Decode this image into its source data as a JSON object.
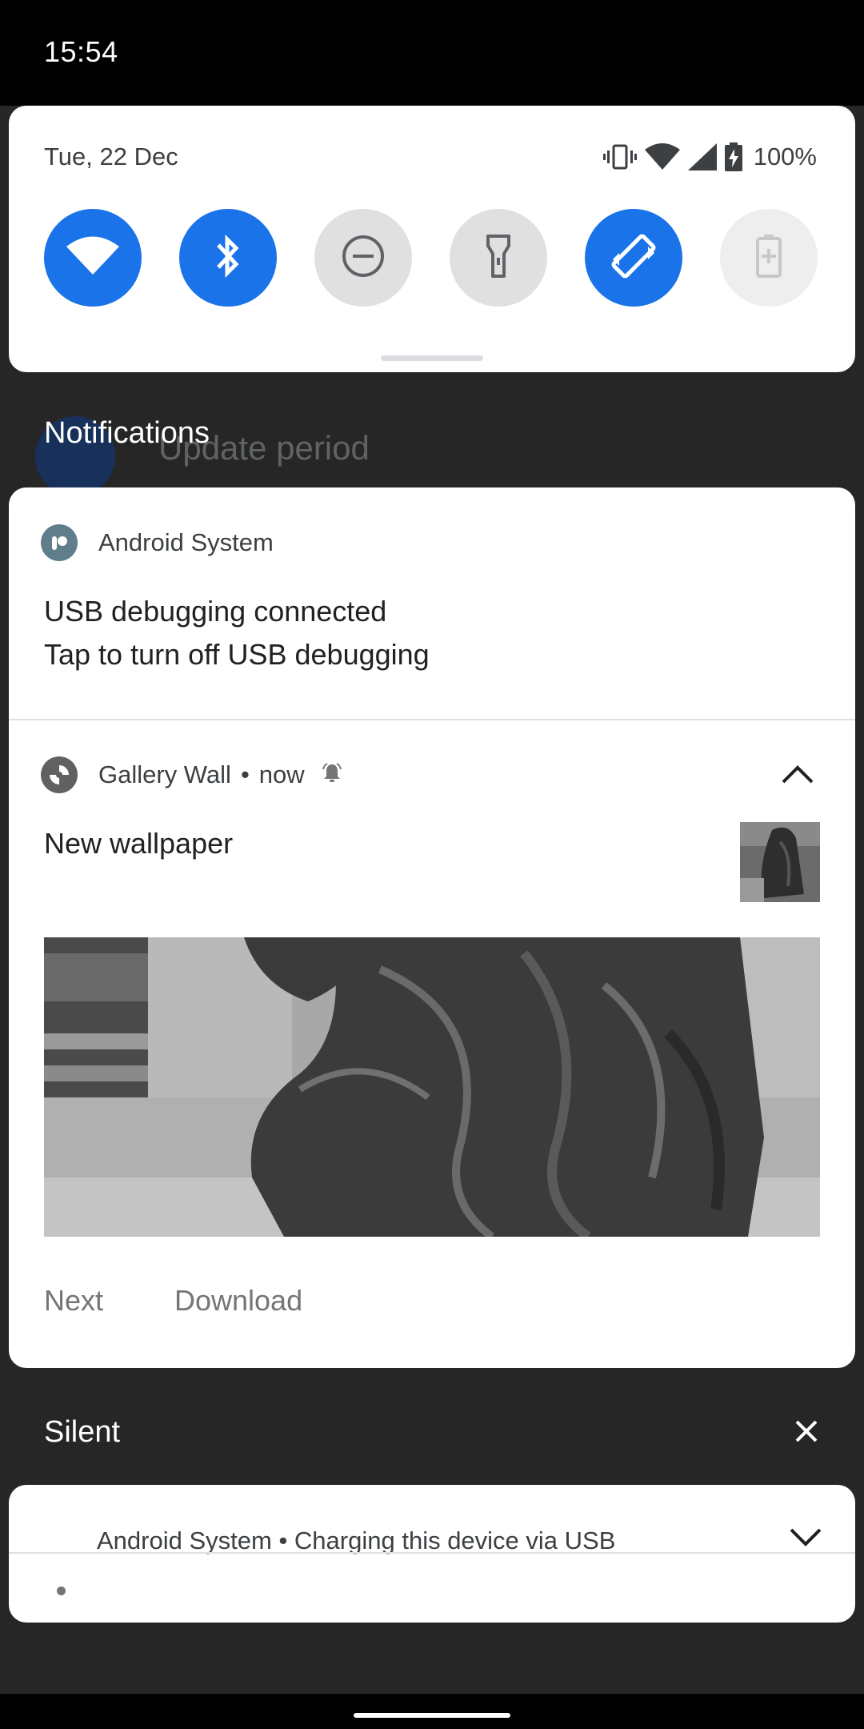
{
  "status_bar": {
    "time": "15:54"
  },
  "quick_settings": {
    "date": "Tue, 22 Dec",
    "battery": "100%",
    "tiles": [
      {
        "name": "Wi-Fi",
        "icon": "wifi-icon",
        "state": "on"
      },
      {
        "name": "Bluetooth",
        "icon": "bluetooth-icon",
        "state": "on"
      },
      {
        "name": "Do Not Disturb",
        "icon": "dnd-icon",
        "state": "off"
      },
      {
        "name": "Flashlight",
        "icon": "flashlight-icon",
        "state": "off"
      },
      {
        "name": "Auto-rotate",
        "icon": "autorotate-icon",
        "state": "on"
      },
      {
        "name": "Battery Saver",
        "icon": "battery-saver-icon",
        "state": "unavailable"
      }
    ]
  },
  "background": {
    "ghost_text": "Update period"
  },
  "notifications_header": "Notifications",
  "notification_usb": {
    "app": "Android System",
    "title": "USB debugging connected",
    "text": "Tap to turn off USB debugging"
  },
  "notification_gallery": {
    "app": "Gallery Wall",
    "time": "now",
    "title": "New wallpaper",
    "actions": [
      "Next",
      "Download"
    ]
  },
  "silent_header": "Silent",
  "notification_silent": {
    "app": "Android System",
    "text": "Charging this device via USB"
  },
  "colors": {
    "accent": "#1a73e8",
    "panel": "#ffffff",
    "shade": "#262626"
  }
}
